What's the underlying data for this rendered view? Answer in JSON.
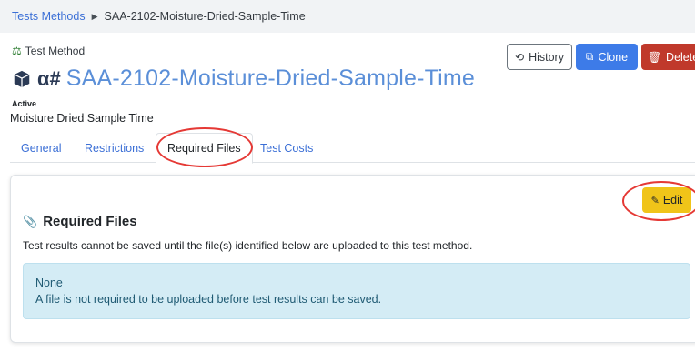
{
  "breadcrumb": {
    "parent": "Tests Methods",
    "current": "SAA-2102-Moisture-Dried-Sample-Time"
  },
  "header": {
    "label": "Test Method",
    "prefix": "α#",
    "title": "SAA-2102-Moisture-Dried-Sample-Time",
    "status": "Active",
    "subtitle": "Moisture Dried Sample Time"
  },
  "actions": {
    "history": "History",
    "clone": "Clone",
    "delete": "Delete"
  },
  "tabs": [
    {
      "label": "General",
      "active": false
    },
    {
      "label": "Restrictions",
      "active": false
    },
    {
      "label": "Required Files",
      "active": true
    },
    {
      "label": "Test Costs",
      "active": false
    }
  ],
  "section": {
    "edit_label": "Edit",
    "title": "Required Files",
    "description": "Test results cannot be saved until the file(s) identified below are uploaded to this test method.",
    "alert_title": "None",
    "alert_text": "A file is not required to be uploaded before test results can be saved."
  },
  "colors": {
    "accent": "#3d7be8",
    "danger": "#c0392b",
    "warning": "#f0c419",
    "info_bg": "#d4ecf5",
    "annotation": "#e53935"
  },
  "icons": [
    "balance-scale-icon",
    "cube-icon",
    "history-icon",
    "copy-icon",
    "trash-icon",
    "pencil-icon",
    "paperclip-icon",
    "chevron-right-icon"
  ]
}
